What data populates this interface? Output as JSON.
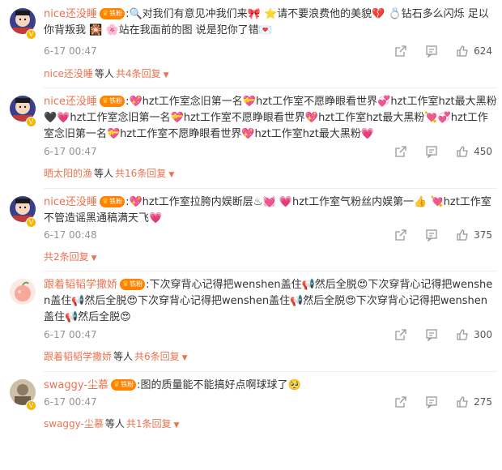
{
  "colors": {
    "username": "#eb7350",
    "time": "#939393",
    "badge": "#ff8200"
  },
  "badge_label": "铁粉",
  "comments": [
    {
      "username": "nice还没睡",
      "text": ":🔍对我们有意见冲我们来🎀 ⭐请不要浪费他的美貌💔 💍钻石多么闪烁 足以你背叛我 🎇 🌸站在我面前的图 说是犯你了错💌",
      "time": "6-17 00:47",
      "likes": "624",
      "reply_user": "nice还没睡",
      "reply_mid": "等人",
      "reply_count": "共4条回复"
    },
    {
      "username": "nice还没睡",
      "text": ":💖hzt工作室念旧第一名💝hzt工作室不愿睁眼看世界💞hzt工作室hzt最大黑粉🖤💗hzt工作室念旧第一名💝hzt工作室不愿睁眼看世界💖hzt工作室hzt最大黑粉💘💞hzt工作室念旧第一名💝hzt工作室不愿睁眼看世界💖hzt工作室hzt最大黑粉💗",
      "time": "6-17 00:47",
      "likes": "450",
      "reply_user": "晒太阳的渔",
      "reply_mid": "等人",
      "reply_count": "共16条回复"
    },
    {
      "username": "nice还没睡",
      "text": ":💖hzt工作室拉胯内娱断层♨💓 💗hzt工作室气粉丝内娱第一👍 💘hzt工作室不管造谣黑通稿满天飞💗",
      "time": "6-17 00:48",
      "likes": "375",
      "reply_user": "",
      "reply_mid": "",
      "reply_count": "共2条回复"
    },
    {
      "username": "跟着韬韬学撒娇",
      "text": ":下次穿背心记得把wenshen盖住📢然后全脱😍下次穿背心记得把wenshen盖住📢然后全脱😍下次穿背心记得把wenshen盖住📢然后全脱😍下次穿背心记得把wenshen盖住📢然后全脱😍",
      "time": "6-17 00:47",
      "likes": "300",
      "reply_user": "跟着韬韬学撒娇",
      "reply_mid": "等人",
      "reply_count": "共6条回复"
    },
    {
      "username": "swaggy-尘慕",
      "text": ":图的质量能不能搞好点啊球球了🥺",
      "time": "6-17 00:47",
      "likes": "275",
      "reply_user": "swaggy-尘慕",
      "reply_mid": "等人",
      "reply_count": "共1条回复"
    }
  ]
}
